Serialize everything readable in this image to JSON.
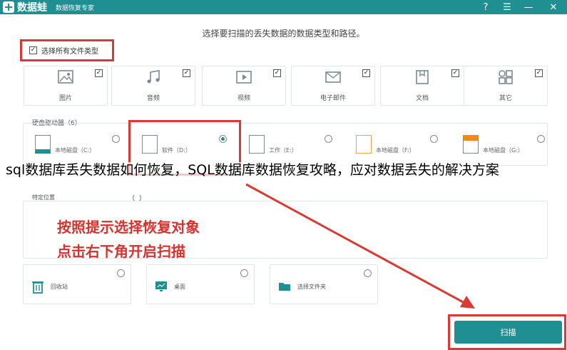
{
  "app": {
    "name": "数据蛙",
    "subtitle": "数据恢复专家"
  },
  "window_controls": {
    "help": "?",
    "menu": "☰",
    "minimize": "—",
    "close": "✕"
  },
  "instruction": "选择要扫描的丢失数据的数据类型和路径。",
  "select_all_label": "选择所有文件类型",
  "file_types": [
    {
      "label": "图片",
      "checked": true,
      "icon": "image-icon"
    },
    {
      "label": "音频",
      "checked": true,
      "icon": "music-icon"
    },
    {
      "label": "视频",
      "checked": true,
      "icon": "video-icon"
    },
    {
      "label": "电子邮件",
      "checked": true,
      "icon": "mail-icon"
    },
    {
      "label": "文档",
      "checked": true,
      "icon": "document-icon"
    },
    {
      "label": "其它",
      "checked": true,
      "icon": "other-icon"
    }
  ],
  "drives_title": "硬盘驱动器（6）",
  "drives": [
    {
      "label": "本地磁盘（C:）",
      "selected": false
    },
    {
      "label": "软件（D:）",
      "selected": true
    },
    {
      "label": "工作（E:）",
      "selected": false
    },
    {
      "label": "本地磁盘（F:）",
      "selected": false
    },
    {
      "label": "本地磁盘（G:）",
      "selected": false
    }
  ],
  "caption": "sql数据库丢失数据如何恢复，SQL数据库数据恢复攻略，应对数据丢失的解决方案",
  "locations_header": "特定位置",
  "hint": {
    "line1": "按照提示选择恢复对象",
    "line2": "点击右下角开启扫描"
  },
  "locations": [
    {
      "label": "回收站",
      "icon": "trash-icon"
    },
    {
      "label": "桌面",
      "icon": "desktop-icon"
    },
    {
      "label": "选择文件夹",
      "icon": "folder-icon"
    }
  ],
  "scan_label": "扫描",
  "colors": {
    "accent": "#1f8f92",
    "highlight": "#d83a35"
  }
}
